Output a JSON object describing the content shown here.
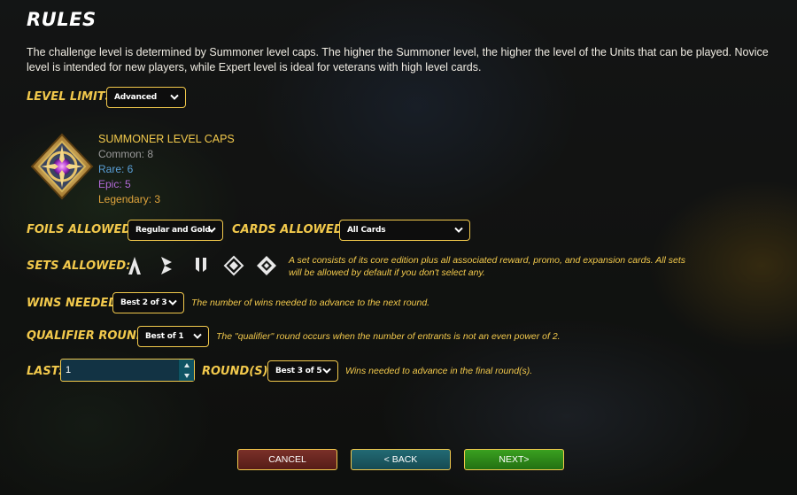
{
  "title": "RULES",
  "description": "The challenge level is determined by Summoner level caps. The higher the Summoner level, the higher the level of the Units that can be played. Novice level is intended for new players, while Expert level is ideal for veterans with high level cards.",
  "level_limits": {
    "label": "LEVEL LIMITS:",
    "value": "Advanced"
  },
  "summoner_caps": {
    "title": "SUMMONER LEVEL CAPS",
    "items": [
      {
        "text": "Common: 8",
        "color": "#9a9a9a"
      },
      {
        "text": "Rare: 6",
        "color": "#5aa0d8"
      },
      {
        "text": "Epic: 5",
        "color": "#b36ad8"
      },
      {
        "text": "Legendary: 3",
        "color": "#e0a43c"
      }
    ]
  },
  "foils": {
    "label": "FOILS ALLOWED:",
    "value": "Regular and Gold"
  },
  "cards": {
    "label": "CARDS ALLOWED:",
    "value": "All Cards"
  },
  "sets": {
    "label": "SETS ALLOWED:",
    "icons": [
      "alpha-set-icon",
      "beta-set-icon",
      "untamed-set-icon",
      "chaos-set-icon",
      "rebellion-set-icon"
    ],
    "hint": "A set consists of its core edition plus all associated reward, promo, and expansion cards. All sets will be allowed by default if you don't select any."
  },
  "wins": {
    "label": "WINS NEEDED:",
    "value": "Best 2 of 3",
    "hint": "The number of wins needed to advance to the next round."
  },
  "qualifier": {
    "label": "QUALIFIER ROUND:",
    "value": "Best of 1",
    "hint": "The \"qualifier\" round occurs when the number of entrants is not an even power of 2."
  },
  "last": {
    "label": "LAST:",
    "value": "1",
    "rounds_label": "ROUND(S):",
    "rounds_value": "Best 3 of 5",
    "hint": "Wins needed to advance in the final round(s)."
  },
  "buttons": {
    "cancel": "CANCEL",
    "back": "< BACK",
    "next": "NEXT>"
  },
  "colors": {
    "accent": "#f2c94c",
    "cancel": "#6b2a25",
    "back": "#1d5a63",
    "next": "#2f8a18"
  }
}
